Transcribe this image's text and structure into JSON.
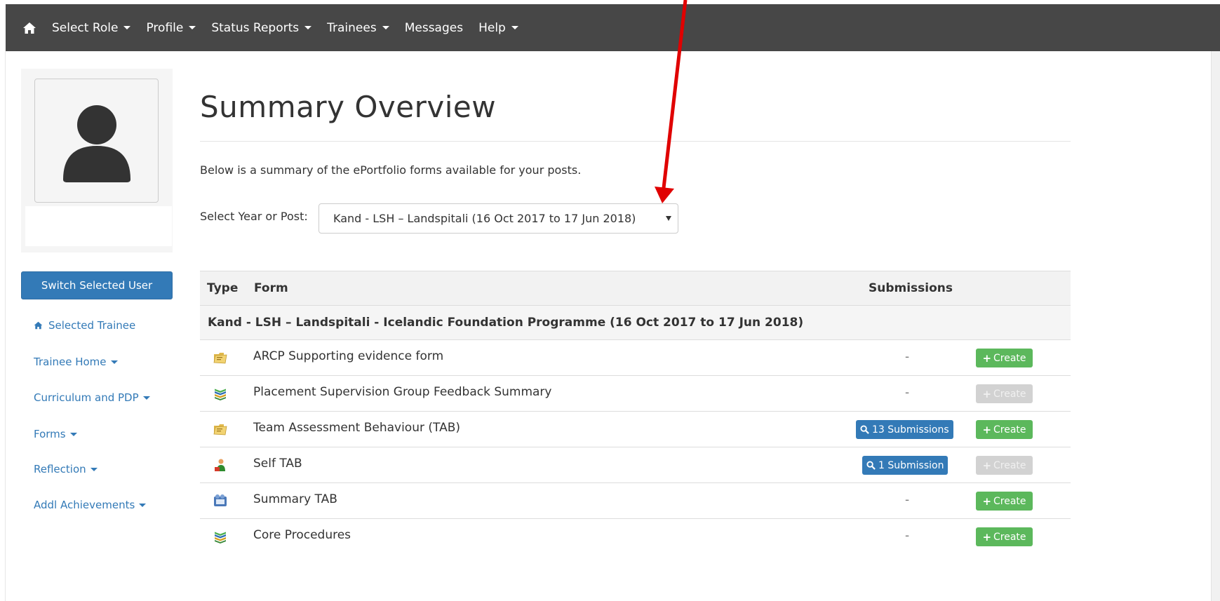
{
  "nav": {
    "items": [
      {
        "label": "Select Role",
        "dropdown": true
      },
      {
        "label": "Profile",
        "dropdown": true
      },
      {
        "label": "Status Reports",
        "dropdown": true
      },
      {
        "label": "Trainees",
        "dropdown": true
      },
      {
        "label": "Messages",
        "dropdown": false
      },
      {
        "label": "Help",
        "dropdown": true
      }
    ]
  },
  "sidebar": {
    "switch_button": "Switch Selected User",
    "selected_trainee": "Selected Trainee",
    "links": [
      {
        "label": "Trainee Home"
      },
      {
        "label": "Curriculum and PDP"
      },
      {
        "label": "Forms"
      },
      {
        "label": "Reflection"
      },
      {
        "label": "Addl Achievements"
      }
    ]
  },
  "main": {
    "title": "Summary Overview",
    "intro": "Below is a summary of the ePortfolio forms available for your posts.",
    "select_label": "Select Year or Post:",
    "select_value": "Kand - LSH – Landspitali (16 Oct 2017 to 17 Jun 2018)"
  },
  "table": {
    "headers": {
      "type": "Type",
      "form": "Form",
      "submissions": "Submissions"
    },
    "group": "Kand - LSH – Landspitali - Icelandic Foundation Programme (16 Oct 2017 to 17 Jun 2018)",
    "rows": [
      {
        "icon": "folder-icon",
        "form": "ARCP Supporting evidence form",
        "submissions": "-",
        "create": "Create",
        "create_enabled": true
      },
      {
        "icon": "books-icon",
        "form": "Placement Supervision Group Feedback Summary",
        "submissions": "-",
        "create": "Create",
        "create_enabled": false
      },
      {
        "icon": "folder-icon",
        "form": "Team Assessment Behaviour (TAB)",
        "submissions": "13 Submissions",
        "create": "Create",
        "create_enabled": true
      },
      {
        "icon": "person-icon",
        "form": "Self TAB",
        "submissions": "1 Submission",
        "create": "Create",
        "create_enabled": false
      },
      {
        "icon": "film-icon",
        "form": "Summary TAB",
        "submissions": "-",
        "create": "Create",
        "create_enabled": true
      },
      {
        "icon": "books-icon",
        "form": "Core Procedures",
        "submissions": "-",
        "create": "Create",
        "create_enabled": true
      }
    ]
  },
  "colors": {
    "navbar": "#474747",
    "primary": "#337ab7",
    "success": "#5cb85c",
    "annotation_arrow": "#e00000"
  }
}
